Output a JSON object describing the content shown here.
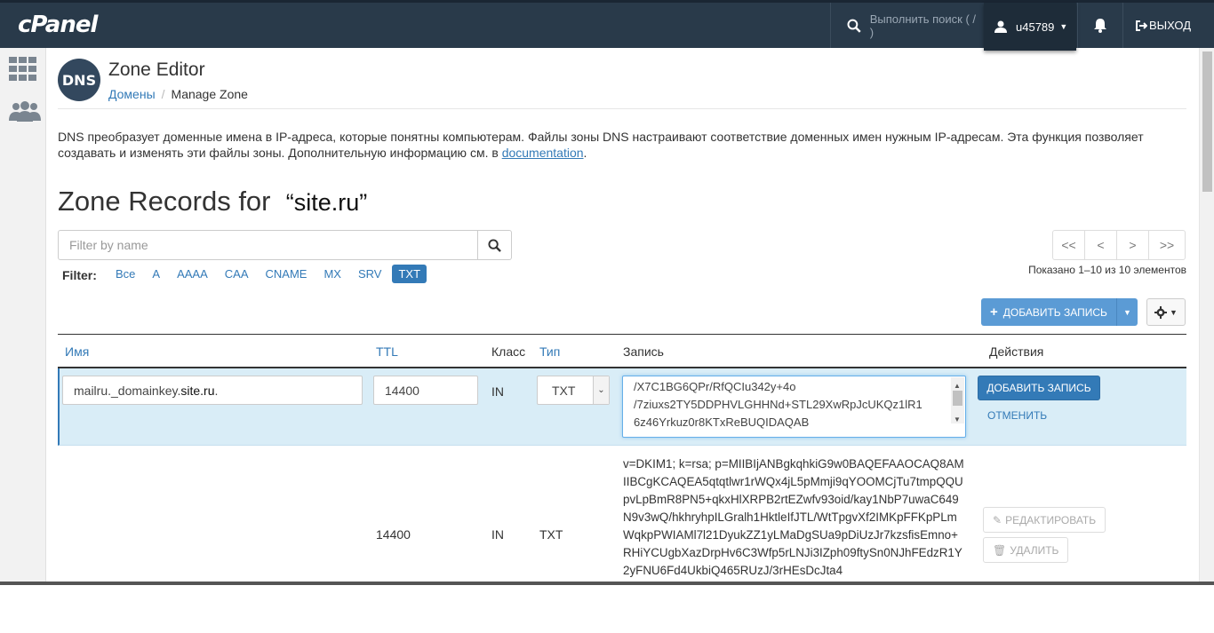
{
  "topbar": {
    "logo": "cPanel",
    "search_placeholder": "Выполнить поиск ( / )",
    "username": "u45789",
    "logout_label": "ВЫХОД"
  },
  "header": {
    "title": "Zone Editor",
    "logo_text": "DNS",
    "breadcrumb": [
      "Домены",
      "Manage Zone"
    ]
  },
  "description": {
    "text": "DNS преобразует доменные имена в IP-адреса, которые понятны компьютерам. Файлы зоны DNS настраивают соответствие доменных имен нужным IP-адресам. Эта функция позволяет создавать и изменять эти файлы зоны. Дополнительную информацию см. в ",
    "link": "documentation",
    "tail": "."
  },
  "zone": {
    "title_prefix": "Zone Records for",
    "domain": "“site.ru”"
  },
  "filter": {
    "placeholder": "Filter by name",
    "label": "Filter:",
    "types": [
      "Все",
      "A",
      "AAAA",
      "CAA",
      "CNAME",
      "MX",
      "SRV",
      "TXT"
    ],
    "active": "TXT"
  },
  "pagination": {
    "buttons": [
      "<<",
      "<",
      ">",
      ">>"
    ],
    "showing": "Показано 1–10 из 10 элементов"
  },
  "toolbar": {
    "add_record": "ДОБАВИТЬ ЗАПИСЬ"
  },
  "table": {
    "headers": {
      "name": "Имя",
      "ttl": "TTL",
      "class": "Класс",
      "type": "Тип",
      "record": "Запись",
      "actions": "Действия"
    },
    "edit_row": {
      "name_prefix": "mailru._domainkey.",
      "name_domain": "site.ru",
      "name_suffix": ".",
      "ttl": "14400",
      "class": "IN",
      "type": "TXT",
      "record_lines": [
        "/X7C1BG6QPr/RfQCIu342y+4o",
        "/7ziuxs2TY5DDPHVLGHHNd+STL29XwRpJcUKQz1lR1",
        "6z46Yrkuz0r8KTxReBUQIDAQAB"
      ],
      "save_label": "ДОБАВИТЬ ЗАПИСЬ",
      "cancel_label": "ОТМЕНИТЬ"
    },
    "rows": [
      {
        "ttl": "14400",
        "class": "IN",
        "type": "TXT",
        "record": "v=DKIM1; k=rsa; p=MIIBIjANBgkqhkiG9w0BAQEFAAOCAQ8AMIIBCgKCAQEA5qtqtlwr1rWQx4jL5pMmji9qYOOMCjTu7tmpQQUpvLpBmR8PN5+qkxHlXRPB2rtEZwfv93oid/kay1NbP7uwaC649N9v3wQ/hkhryhpILGralh1HktleIfJTL/WtTpgvXf2IMKpFFKpPLmWqkpPWIAMl7l21DyukZZ1yLMaDgSUa9pDiUzJr7kzsfisEmno+RHiYCUgbXazDrpHv6C3Wfp5rLNJi3IZph09ftySn0NJhFEdzR1Y2yFNU6Fd4UkbiQ465RUzJ/3rHEsDcJta4",
        "edit_label": "РЕДАКТИРОВАТЬ",
        "delete_label": "УДАЛИТЬ"
      }
    ]
  }
}
